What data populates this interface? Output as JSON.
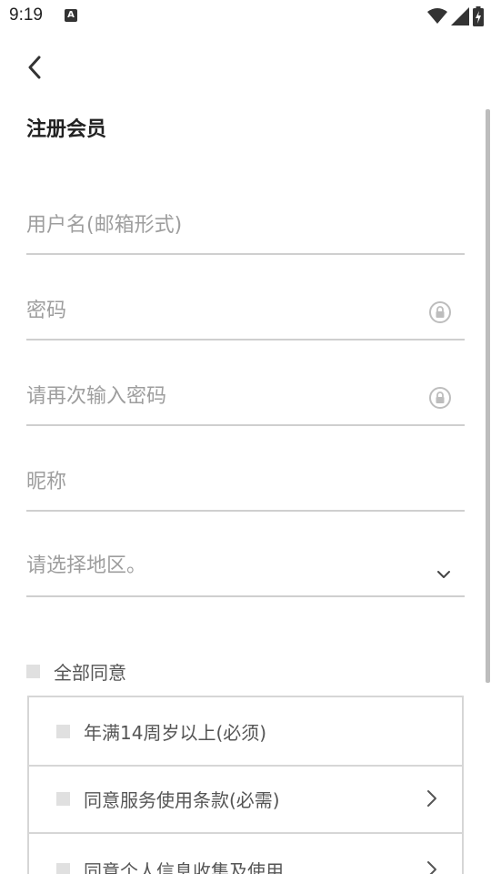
{
  "status_bar": {
    "time": "9:19",
    "notification_icon": "a-badge-icon",
    "icons": [
      "wifi-icon",
      "signal-icon",
      "battery-charging-icon"
    ]
  },
  "header": {
    "back_icon": "back-arrow-icon",
    "title": "注册会员"
  },
  "form": {
    "username_placeholder": "用户名(邮箱形式)",
    "password_placeholder": "密码",
    "password_confirm_placeholder": "请再次输入密码",
    "nickname_placeholder": "昵称",
    "region_placeholder": "请选择地区。"
  },
  "agreements": {
    "all_label": "全部同意",
    "items": [
      {
        "label": "年满14周岁以上(必须)"
      },
      {
        "label": "同意服务使用条款(必需)"
      },
      {
        "label": "同意个人信息收集及使用"
      }
    ]
  },
  "colors": {
    "divider": "#cfcfcf",
    "placeholder": "#9e9e9e",
    "checkbox": "#e0e0e0"
  }
}
